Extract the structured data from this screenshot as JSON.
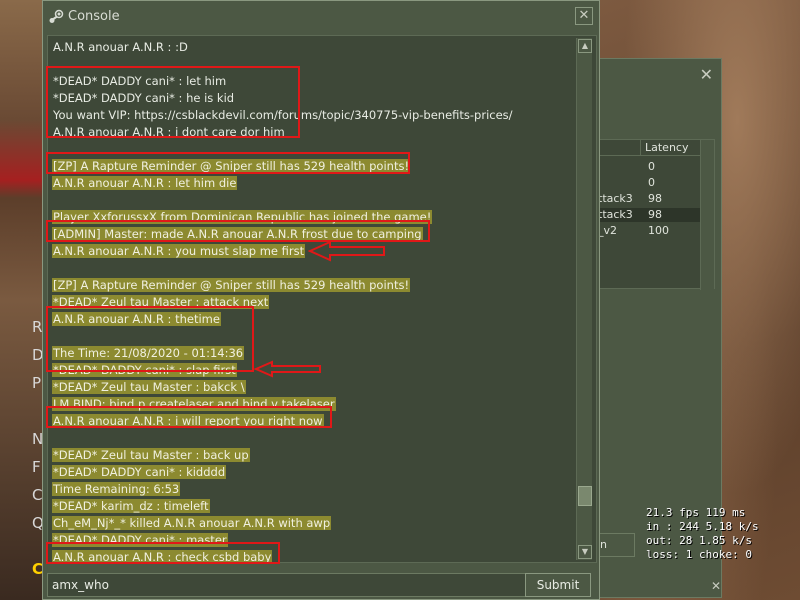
{
  "console": {
    "title": "Console",
    "close_glyph": "✕",
    "icon": "steam-icon",
    "lines": [
      {
        "text": "A.N.R anouar A.N.R :  :D",
        "highlight": false
      },
      {
        "text": "",
        "highlight": false
      },
      {
        "text": "*DEAD* DADDY cani* :  let him",
        "highlight": false
      },
      {
        "text": "*DEAD* DADDY cani* :  he is kid",
        "highlight": false
      },
      {
        "text": "You want VIP: https://csblackdevil.com/forums/topic/340775-vip-benefits-prices/",
        "highlight": false
      },
      {
        "text": "A.N.R anouar A.N.R :  i dont care dor him",
        "highlight": false
      },
      {
        "text": "",
        "highlight": false
      },
      {
        "text": "[ZP] A Rapture Reminder @ Sniper still has 529 health points!",
        "highlight": true
      },
      {
        "text": "A.N.R anouar A.N.R :  let him die",
        "highlight": true
      },
      {
        "text": "",
        "highlight": false
      },
      {
        "text": "Player XxforussxX from Dominican Republic has joined the game!",
        "highlight": true
      },
      {
        "text": "[ADMIN] Master: made A.N.R anouar A.N.R frost due to camping",
        "highlight": true
      },
      {
        "text": "A.N.R anouar A.N.R :  you must slap me first",
        "highlight": true
      },
      {
        "text": "",
        "highlight": false
      },
      {
        "text": "[ZP] A Rapture Reminder @ Sniper still has 529 health points!",
        "highlight": true
      },
      {
        "text": "*DEAD* Zeul tau Master :  attack next",
        "highlight": true
      },
      {
        "text": "A.N.R anouar A.N.R :  thetime",
        "highlight": true
      },
      {
        "text": "",
        "highlight": false
      },
      {
        "text": "The Time:  21/08/2020 - 01:14:36",
        "highlight": true
      },
      {
        "text": "*DEAD* DADDY cani* :  slap first",
        "highlight": true
      },
      {
        "text": "*DEAD* Zeul tau Master :  bakck \\",
        "highlight": true
      },
      {
        "text": "LM BIND: bind p createlaser and bind v takelaser",
        "highlight": true
      },
      {
        "text": "A.N.R anouar A.N.R :  i will report you right now",
        "highlight": true
      },
      {
        "text": "",
        "highlight": false
      },
      {
        "text": "*DEAD* Zeul tau Master :  back up",
        "highlight": true
      },
      {
        "text": "*DEAD* DADDY cani* :  kidddd",
        "highlight": true
      },
      {
        "text": "Time Remaining: 6:53",
        "highlight": true
      },
      {
        "text": "*DEAD* karim_dz :  timeleft",
        "highlight": true
      },
      {
        "text": "Ch_eM_Nj*_* killed A.N.R anouar A.N.R with awp",
        "highlight": true
      },
      {
        "text": "*DEAD* DADDY cani* :  master",
        "highlight": true
      },
      {
        "text": "A.N.R anouar A.N.R :  check csbd baby",
        "highlight": true
      }
    ],
    "input_value": "amx_who",
    "submit_label": "Submit"
  },
  "scoreboard": {
    "close_glyph": "✕",
    "col_latency": "Latency",
    "rows": [
      {
        "name": "",
        "latency": "0",
        "selected": false
      },
      {
        "name": "",
        "latency": "0",
        "selected": false
      },
      {
        "name": "ttack3",
        "latency": "98",
        "selected": false
      },
      {
        "name": "ttack3",
        "latency": "98",
        "selected": true
      },
      {
        "name": "_v2",
        "latency": "100",
        "selected": false
      }
    ],
    "button_label": "n",
    "bottom_close_glyph": "✕"
  },
  "netstats": {
    "line1": "21.3 fps   119 ms",
    "line2": "in :  244 5.18 k/s",
    "line3": "out: 28 1.85 k/s",
    "line4": "loss: 1 choke:  0"
  },
  "background_menu": {
    "letters": [
      "R",
      "D",
      "P",
      "N",
      "F",
      "C",
      "Q",
      "C"
    ]
  },
  "colors": {
    "panel": "#4c5844",
    "panel_dark": "#3e4838",
    "highlight": "#8c8a30",
    "annotation": "#e01818"
  }
}
